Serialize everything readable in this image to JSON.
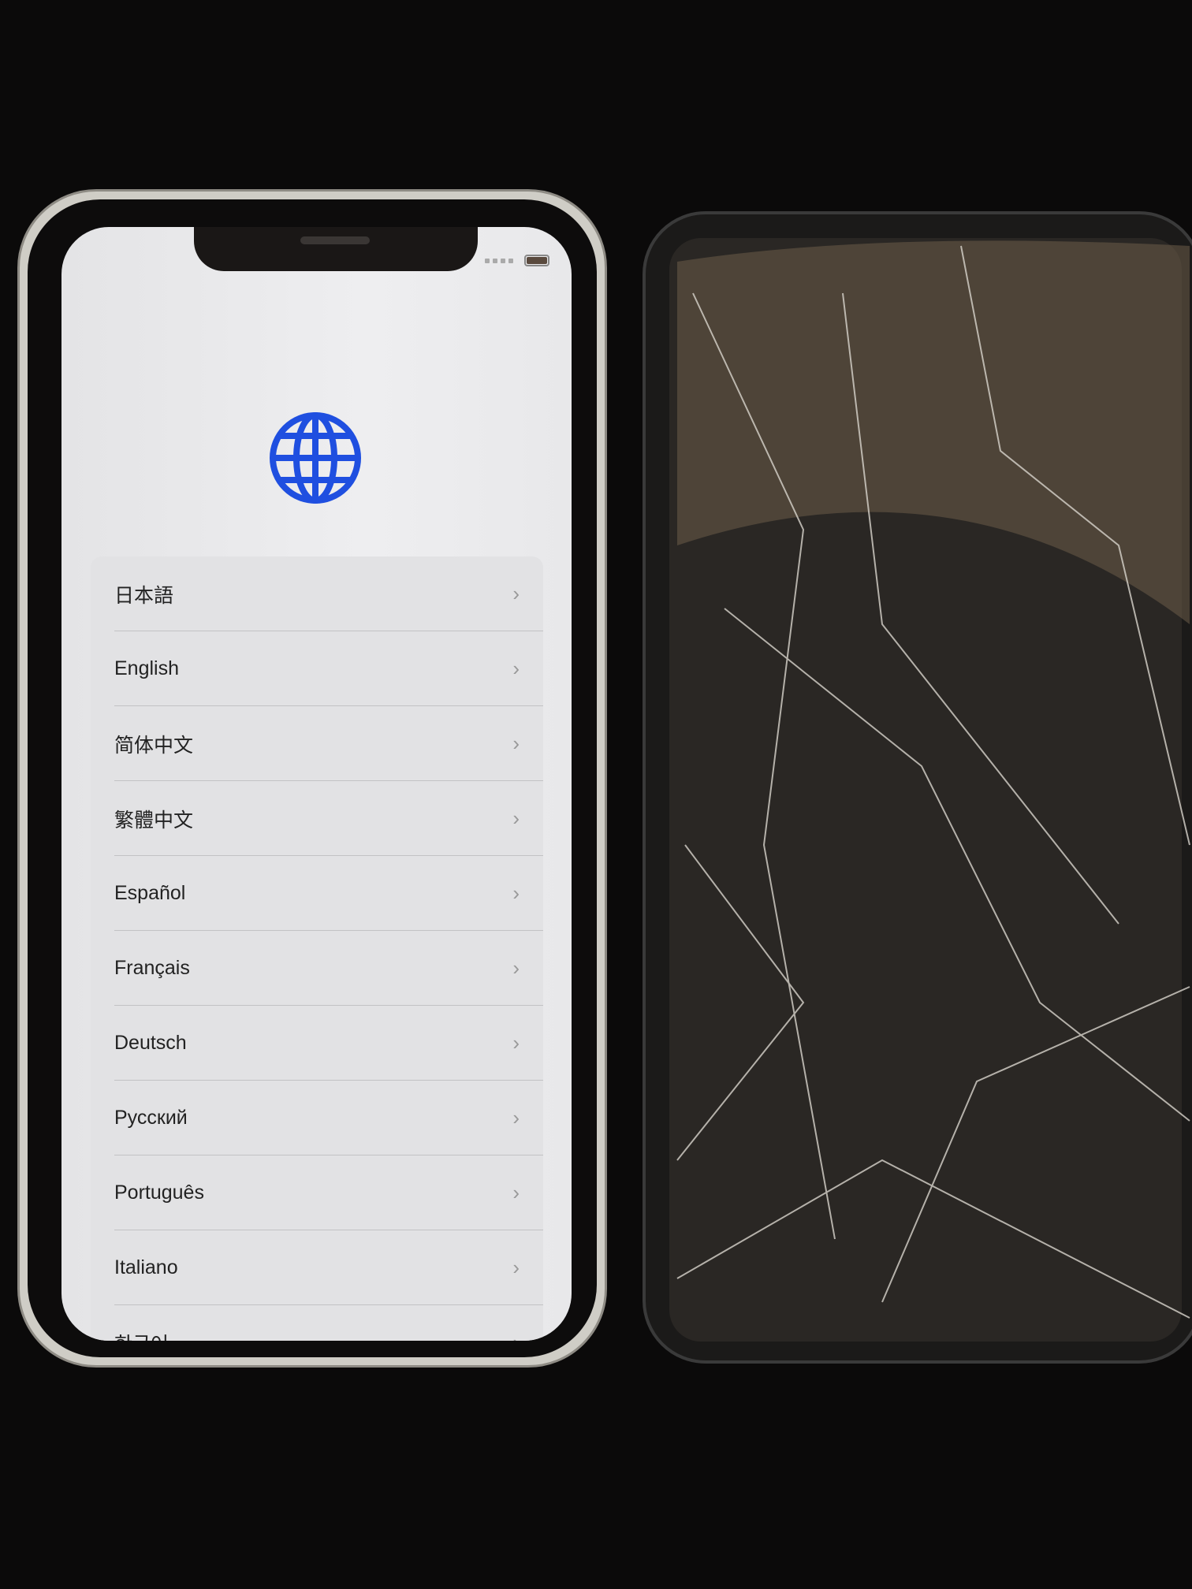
{
  "status_bar": {
    "signal_icon": "signal-dots-icon",
    "battery_icon": "battery-icon"
  },
  "header": {
    "icon": "globe-icon",
    "accent": "#1f4fe0"
  },
  "languages": [
    {
      "label": "日本語"
    },
    {
      "label": "English"
    },
    {
      "label": "简体中文"
    },
    {
      "label": "繁體中文"
    },
    {
      "label": "Español"
    },
    {
      "label": "Français"
    },
    {
      "label": "Deutsch"
    },
    {
      "label": "Русский"
    },
    {
      "label": "Português"
    },
    {
      "label": "Italiano"
    },
    {
      "label": "한국어"
    }
  ],
  "chevron": "›"
}
